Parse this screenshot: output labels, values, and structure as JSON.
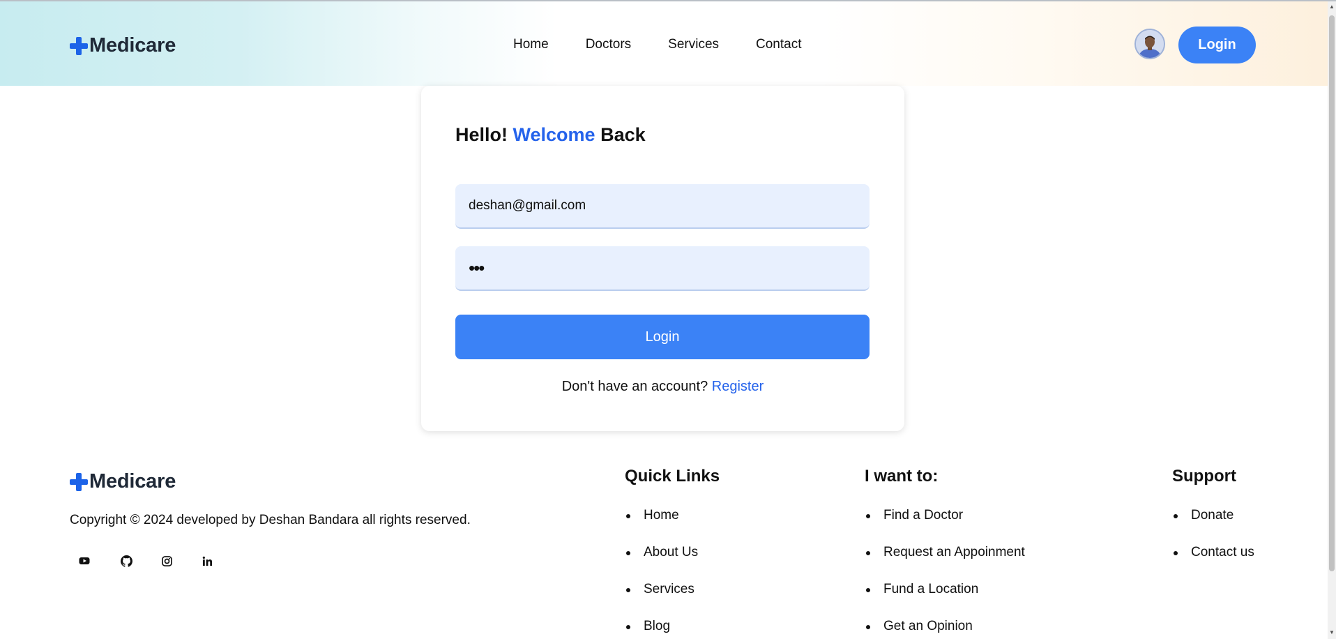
{
  "brand": {
    "name": "Medicare"
  },
  "header": {
    "nav": [
      "Home",
      "Doctors",
      "Services",
      "Contact"
    ],
    "login_label": "Login"
  },
  "login_card": {
    "title_part1": "Hello!",
    "title_accent": "Welcome",
    "title_part2": "Back",
    "email_value": "deshan@gmail.com",
    "password_value": "•••",
    "submit_label": "Login",
    "register_prompt": "Don't have an account?",
    "register_link": "Register"
  },
  "footer": {
    "copyright": "Copyright © 2024 developed by Deshan Bandara all rights reserved.",
    "social_icons": [
      "youtube-icon",
      "github-icon",
      "instagram-icon",
      "linkedin-icon"
    ],
    "columns": [
      {
        "title": "Quick Links",
        "items": [
          "Home",
          "About Us",
          "Services",
          "Blog"
        ]
      },
      {
        "title": "I want to:",
        "items": [
          "Find a Doctor",
          "Request an Appoinment",
          "Fund a Location",
          "Get an Opinion"
        ]
      },
      {
        "title": "Support",
        "items": [
          "Donate",
          "Contact us"
        ]
      }
    ]
  },
  "colors": {
    "accent": "#3b82f6",
    "brand_blue": "#1c63e8",
    "input_bg": "#e8f0fe"
  }
}
